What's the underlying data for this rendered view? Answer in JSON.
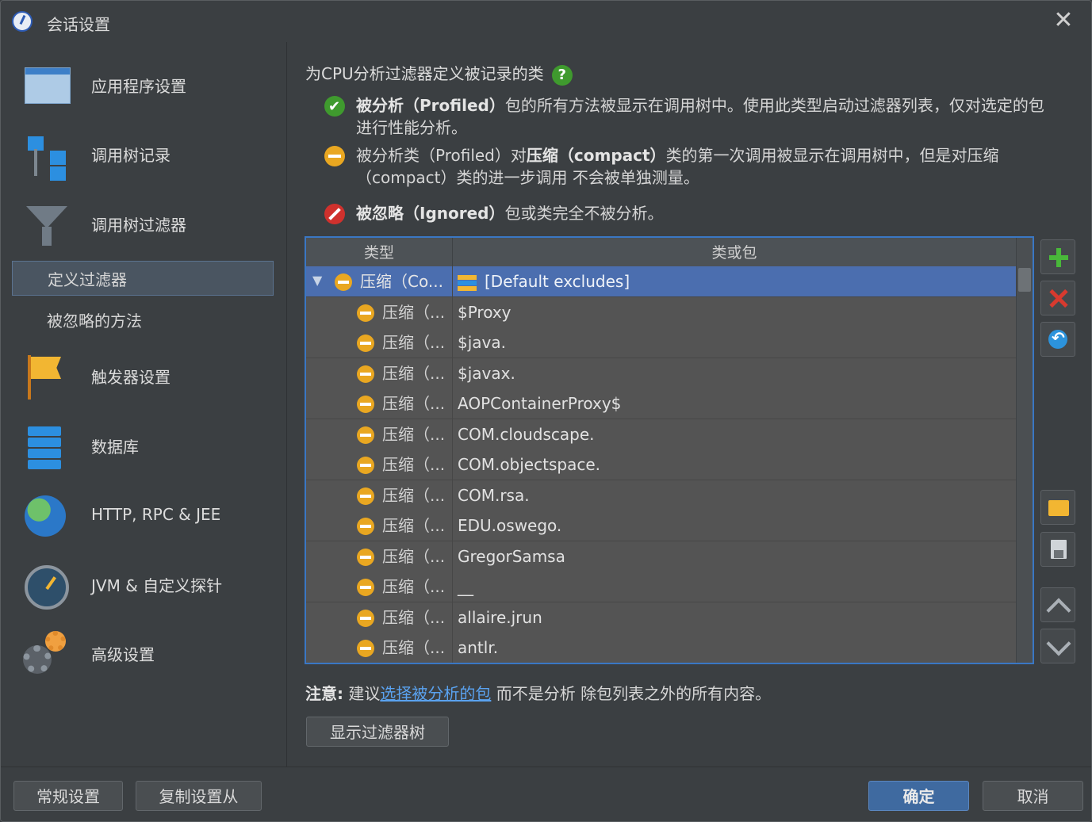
{
  "window": {
    "title": "会话设置"
  },
  "sidebar": {
    "items": [
      {
        "label": "应用程序设置",
        "icon": "app-settings-icon"
      },
      {
        "label": "调用树记录",
        "icon": "call-tree-icon"
      },
      {
        "label": "调用树过滤器",
        "icon": "funnel-icon"
      },
      {
        "label": "定义过滤器",
        "selected": true
      },
      {
        "label": "被忽略的方法"
      },
      {
        "label": "触发器设置",
        "icon": "flag-icon"
      },
      {
        "label": "数据库",
        "icon": "database-icon"
      },
      {
        "label": "HTTP, RPC & JEE",
        "icon": "globe-icon"
      },
      {
        "label": "JVM & 自定义探针",
        "icon": "gauge-icon"
      },
      {
        "label": "高级设置",
        "icon": "gears-icon"
      }
    ]
  },
  "main": {
    "heading": "为CPU分析过滤器定义被记录的类",
    "help": "?",
    "legend": {
      "profiled_bold": "被分析（Profiled）",
      "profiled_rest": "包的所有方法被显示在调用树中。使用此类型启动过滤器列表，仅对选定的包进行性能分析。",
      "compact_pre": "被分析类（Profiled）对",
      "compact_bold": "压缩（compact）",
      "compact_rest": "类的第一次调用被显示在调用树中，但是对压缩（compact）类的进一步调用 不会被单独测量。",
      "ignored_bold": "被忽略（Ignored）",
      "ignored_rest": "包或类完全不被分析。"
    },
    "table": {
      "columns": [
        "类型",
        "类或包"
      ],
      "group_row": {
        "type": "压缩（Co...",
        "package": "[Default excludes]"
      },
      "rows": [
        {
          "type": "压缩（...",
          "package": "$Proxy"
        },
        {
          "type": "压缩（...",
          "package": "$java."
        },
        {
          "type": "压缩（...",
          "package": "$javax."
        },
        {
          "type": "压缩（...",
          "package": "AOPContainerProxy$"
        },
        {
          "type": "压缩（...",
          "package": "COM.cloudscape."
        },
        {
          "type": "压缩（...",
          "package": "COM.objectspace."
        },
        {
          "type": "压缩（...",
          "package": "COM.rsa."
        },
        {
          "type": "压缩（...",
          "package": "EDU.oswego."
        },
        {
          "type": "压缩（...",
          "package": "GregorSamsa"
        },
        {
          "type": "压缩（...",
          "package": "__"
        },
        {
          "type": "压缩（...",
          "package": "allaire.jrun"
        },
        {
          "type": "压缩（...",
          "package": "antlr."
        }
      ]
    },
    "note": {
      "label": "注意:",
      "pre": " 建议",
      "link": "选择被分析的包",
      "post": " 而不是分析 除包列表之外的所有内容。"
    },
    "show_tree_button": "显示过滤器树"
  },
  "footer": {
    "general_button": "常规设置",
    "copy_button": "复制设置从",
    "ok_button": "确定",
    "cancel_button": "取消"
  },
  "colors": {
    "accent": "#3a77c4",
    "selected_row": "#4b6eaf",
    "compact": "#e9a721",
    "profiled": "#3f9a2e",
    "ignored": "#d0312d"
  }
}
